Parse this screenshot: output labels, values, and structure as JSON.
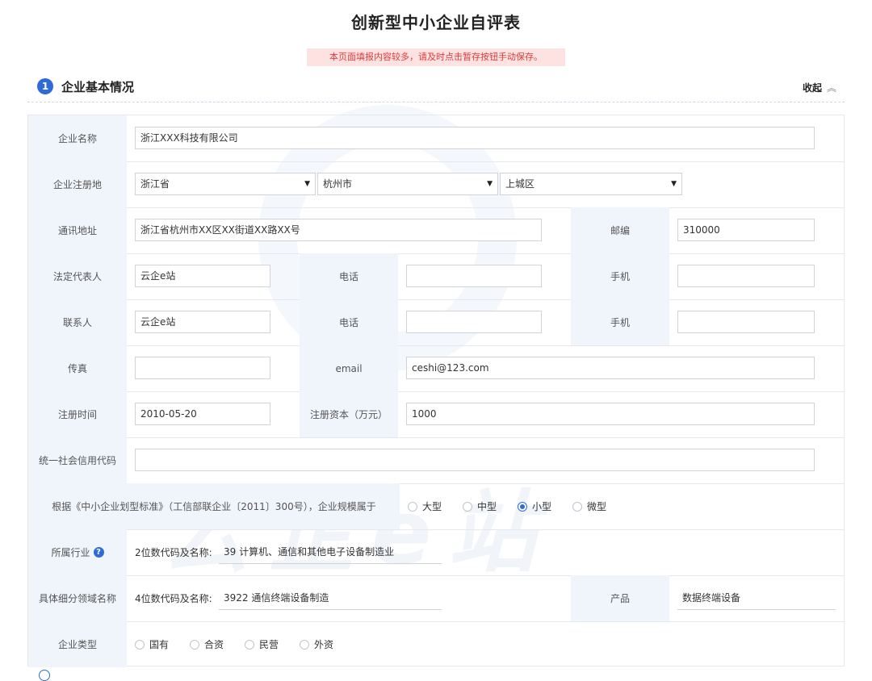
{
  "page": {
    "title": "创新型中小企业自评表",
    "notice": "本页面填报内容较多，请及时点击暂存按钮手动保存。"
  },
  "section1": {
    "number": "1",
    "title": "企业基本情况",
    "collapse_label": "收起",
    "collapse_icon": "chevron-up-double-icon"
  },
  "form": {
    "company_name": {
      "label": "企业名称",
      "value": "浙江XXX科技有限公司"
    },
    "registered_place": {
      "label": "企业注册地",
      "province": "浙江省",
      "city": "杭州市",
      "district": "上城区"
    },
    "address": {
      "label": "通讯地址",
      "value": "浙江省杭州市XX区XX街道XX路XX号"
    },
    "postcode": {
      "label": "邮编",
      "value": "310000"
    },
    "legal_rep": {
      "label": "法定代表人",
      "value": "云企e站"
    },
    "legal_phone": {
      "label": "电话",
      "value": ""
    },
    "legal_mobile": {
      "label": "手机",
      "value": ""
    },
    "contact": {
      "label": "联系人",
      "value": "云企e站"
    },
    "contact_phone": {
      "label": "电话",
      "value": ""
    },
    "contact_mobile": {
      "label": "手机",
      "value": ""
    },
    "fax": {
      "label": "传真",
      "value": ""
    },
    "email": {
      "label": "email",
      "value": "ceshi@123.com"
    },
    "reg_date": {
      "label": "注册时间",
      "value": "2010-05-20"
    },
    "reg_capital": {
      "label": "注册资本（万元）",
      "value": "1000"
    },
    "credit_code": {
      "label": "统一社会信用代码",
      "value": ""
    },
    "scale": {
      "label": "根据《中小企业划型标准》（工信部联企业〔2011〕300号），企业规模属于",
      "options": [
        "大型",
        "中型",
        "小型",
        "微型"
      ],
      "selected": "小型"
    },
    "industry": {
      "label": "所属行业",
      "prefix": "2位数代码及名称:",
      "value": "39 计算机、通信和其他电子设备制造业"
    },
    "subfield": {
      "label": "具体细分领域名称",
      "prefix": "4位数代码及名称:",
      "value": "3922 通信终端设备制造"
    },
    "product": {
      "label": "产品",
      "value": "数据终端设备"
    },
    "company_type": {
      "label": "企业类型",
      "options": [
        "国有",
        "合资",
        "民营",
        "外资"
      ],
      "selected": ""
    }
  },
  "watermark": {
    "text": "云企e站"
  },
  "colors": {
    "accent": "#2e6bd6",
    "label_bg": "#f0f4fb",
    "notice_bg": "#fde2e2",
    "notice_text": "#e03b3b"
  }
}
